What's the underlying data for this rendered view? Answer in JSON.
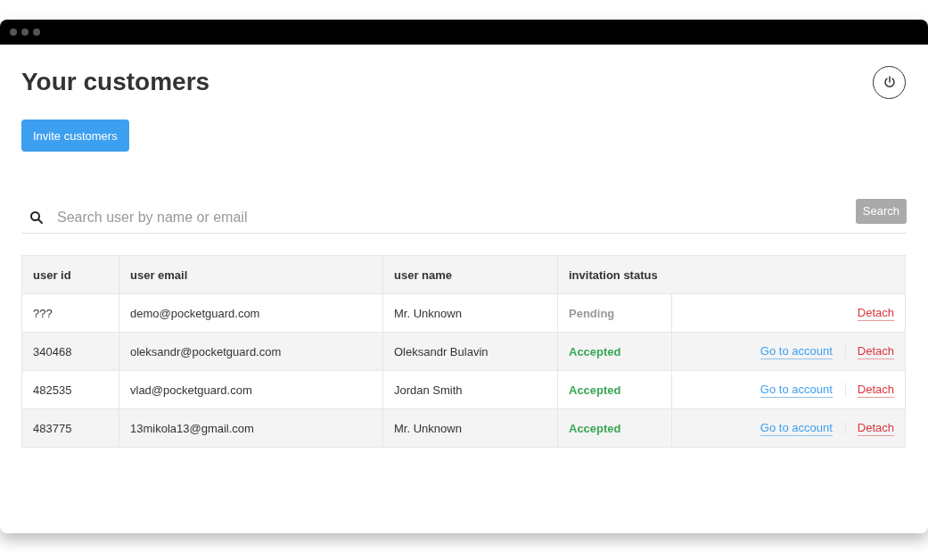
{
  "page": {
    "title": "Your customers",
    "invite_button": "Invite customers"
  },
  "search": {
    "placeholder": "Search user by name or email",
    "button": "Search"
  },
  "table": {
    "columns": [
      "user id",
      "user email",
      "user name",
      "invitation status"
    ],
    "rows": [
      {
        "id": "???",
        "email": "demo@pocketguard.com",
        "name": "Mr. Unknown",
        "status": {
          "kind": "pending",
          "label": "Pending"
        },
        "actions": [
          {
            "kind": "detach",
            "label": "Detach"
          }
        ]
      },
      {
        "id": "340468",
        "email": "oleksandr@pocketguard.com",
        "name": "Oleksandr Bulavin",
        "status": {
          "kind": "accepted",
          "label": "Accepted"
        },
        "actions": [
          {
            "kind": "account",
            "label": "Go to account"
          },
          {
            "kind": "detach",
            "label": "Detach"
          }
        ]
      },
      {
        "id": "482535",
        "email": "vlad@pocketguard.com",
        "name": "Jordan Smith",
        "status": {
          "kind": "accepted",
          "label": "Accepted"
        },
        "actions": [
          {
            "kind": "account",
            "label": "Go to account"
          },
          {
            "kind": "detach",
            "label": "Detach"
          }
        ]
      },
      {
        "id": "483775",
        "email": "13mikola13@gmail.com",
        "name": "Mr. Unknown",
        "status": {
          "kind": "accepted",
          "label": "Accepted"
        },
        "actions": [
          {
            "kind": "account",
            "label": "Go to account"
          },
          {
            "kind": "detach",
            "label": "Detach"
          }
        ]
      }
    ]
  }
}
